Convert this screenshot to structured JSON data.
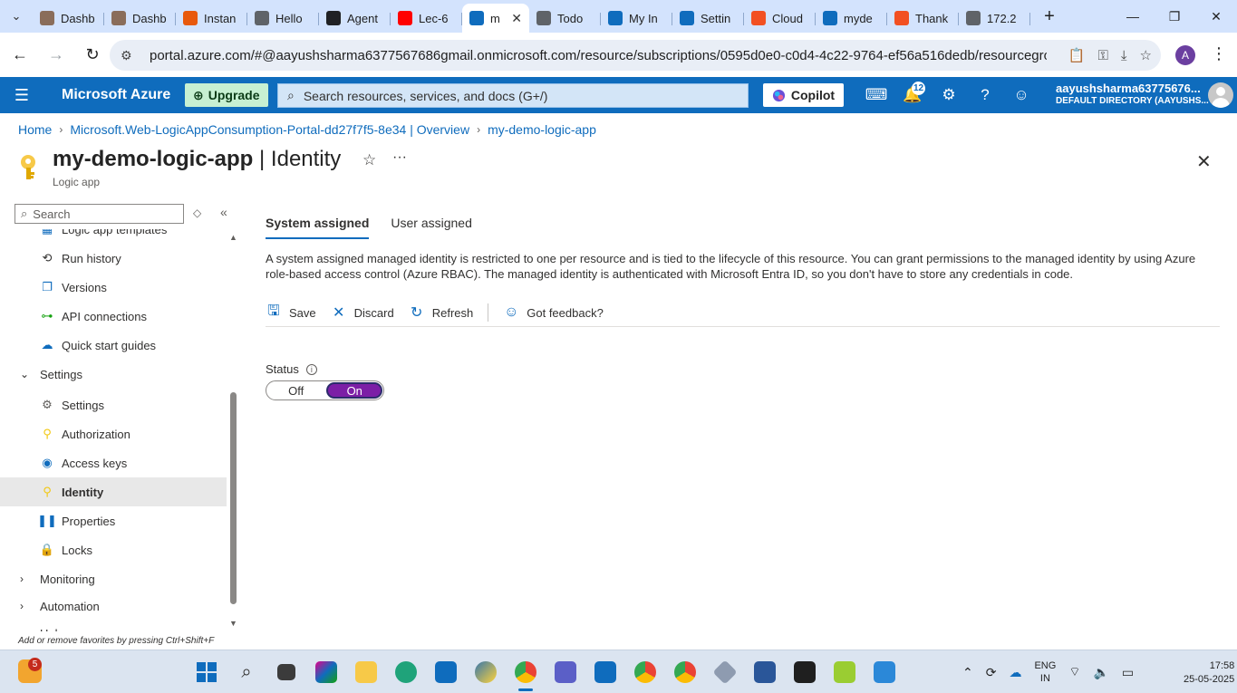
{
  "browser": {
    "tabs": [
      {
        "label": "Dashb",
        "icon": "avatar-icon",
        "color": "#8a6d5a"
      },
      {
        "label": "Dashb",
        "icon": "avatar-icon",
        "color": "#8a6d5a"
      },
      {
        "label": "Instan",
        "icon": "orange-app-icon",
        "color": "#e8590c"
      },
      {
        "label": "Hello",
        "icon": "globe-icon",
        "color": "#5f6368"
      },
      {
        "label": "Agent",
        "icon": "openai-icon",
        "color": "#202124"
      },
      {
        "label": "Lec-6",
        "icon": "youtube-icon",
        "color": "#ff0000"
      },
      {
        "label": "m",
        "icon": "azure-icon",
        "color": "#0f6cbd",
        "active": true
      },
      {
        "label": "Todo",
        "icon": "globe-icon",
        "color": "#5f6368"
      },
      {
        "label": "My In",
        "icon": "devops-icon",
        "color": "#0f6cbd"
      },
      {
        "label": "Settin",
        "icon": "vscode-icon",
        "color": "#0f6cbd"
      },
      {
        "label": "Cloud",
        "icon": "microsoft-icon",
        "color": "#f25022"
      },
      {
        "label": "myde",
        "icon": "azure-icon",
        "color": "#0f6cbd"
      },
      {
        "label": "Thank",
        "icon": "microsoft-icon",
        "color": "#f25022"
      },
      {
        "label": "172.2",
        "icon": "globe-icon",
        "color": "#5f6368"
      }
    ],
    "url": "portal.azure.com/#@aayushsharma6377567686gmail.onmicrosoft.com/resource/subscriptions/0595d0e0-c0d4-4c22-9764-ef56a516dedb/resourcegroups/my...",
    "profile_initial": "A"
  },
  "azure": {
    "brand": "Microsoft Azure",
    "upgrade_label": "Upgrade",
    "search_placeholder": "Search resources, services, and docs (G+/)",
    "copilot_label": "Copilot",
    "notification_count": "12",
    "account_name": "aayushsharma63775676...",
    "account_directory": "DEFAULT DIRECTORY (AAYUSHS..."
  },
  "breadcrumb": {
    "home": "Home",
    "resource_group": "Microsoft.Web-LogicAppConsumption-Portal-dd27f7f5-8e34 | Overview",
    "resource": "my-demo-logic-app"
  },
  "header": {
    "title_resource": "my-demo-logic-app",
    "title_separator": " | ",
    "title_page": "Identity",
    "subtitle": "Logic app"
  },
  "menu": {
    "search_placeholder": "Search",
    "items": [
      {
        "label": "Logic app templates",
        "type": "child",
        "icon": "template-icon"
      },
      {
        "label": "Run history",
        "type": "child",
        "icon": "history-icon"
      },
      {
        "label": "Versions",
        "type": "child",
        "icon": "versions-icon"
      },
      {
        "label": "API connections",
        "type": "child",
        "icon": "link-icon"
      },
      {
        "label": "Quick start guides",
        "type": "child",
        "icon": "cloud-icon"
      },
      {
        "label": "Settings",
        "type": "group",
        "expanded": true
      },
      {
        "label": "Settings",
        "type": "child",
        "icon": "gear-icon"
      },
      {
        "label": "Authorization",
        "type": "child",
        "icon": "key-icon"
      },
      {
        "label": "Access keys",
        "type": "child",
        "icon": "access-keys-icon"
      },
      {
        "label": "Identity",
        "type": "child",
        "icon": "identity-icon",
        "selected": true
      },
      {
        "label": "Properties",
        "type": "child",
        "icon": "properties-icon"
      },
      {
        "label": "Locks",
        "type": "child",
        "icon": "lock-icon"
      },
      {
        "label": "Monitoring",
        "type": "group",
        "expanded": false
      },
      {
        "label": "Automation",
        "type": "group",
        "expanded": false
      },
      {
        "label": "Help",
        "type": "group",
        "expanded": false
      }
    ],
    "favorites_hint": "Add or remove favorites by pressing Ctrl+Shift+F"
  },
  "identity": {
    "tabs": [
      "System assigned",
      "User assigned"
    ],
    "active_tab": "System assigned",
    "description": "A system assigned managed identity is restricted to one per resource and is tied to the lifecycle of this resource. You can grant permissions to the managed identity by using Azure role-based access control (Azure RBAC). The managed identity is authenticated with Microsoft Entra ID, so you don't have to store any credentials in code.",
    "commands": {
      "save": "Save",
      "discard": "Discard",
      "refresh": "Refresh",
      "feedback": "Got feedback?"
    },
    "status_label": "Status",
    "toggle_off": "Off",
    "toggle_on": "On",
    "status_value": "On"
  },
  "taskbar": {
    "widget_badge": "5",
    "lang_line1": "ENG",
    "lang_line2": "IN",
    "time": "17:58",
    "date": "25-05-2025"
  },
  "colors": {
    "azure_blue": "#0f6cbd",
    "toggle_on": "#7c1fa6",
    "upgrade_bg": "#c7f0d2"
  }
}
